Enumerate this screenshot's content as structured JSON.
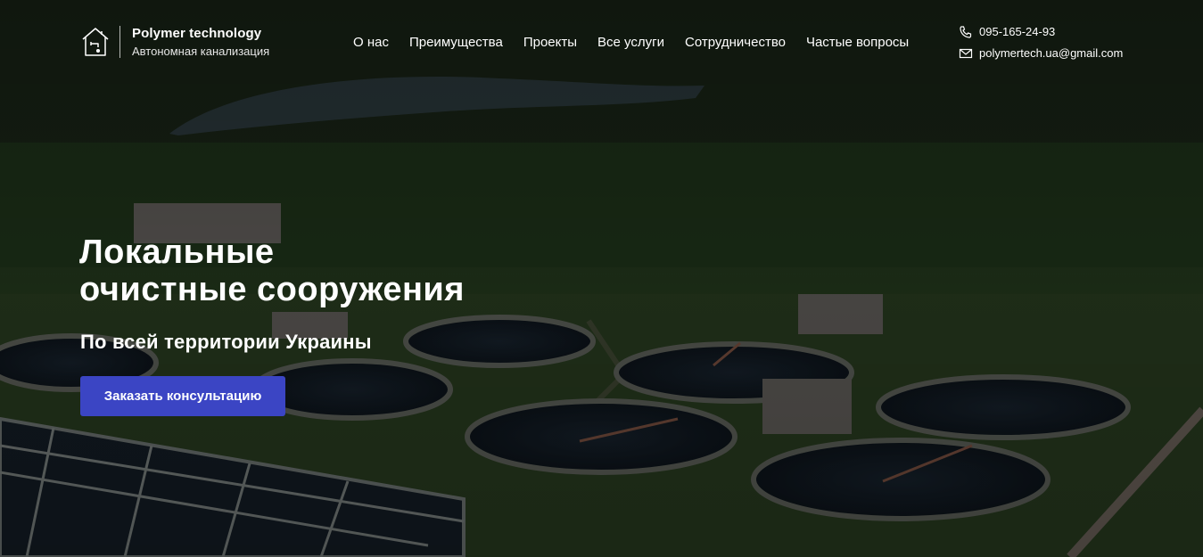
{
  "brand": {
    "name": "Polymer technology",
    "tagline": "Автономная канализация",
    "icon": "house-faucet-icon"
  },
  "nav": {
    "items": [
      {
        "label": "О нас"
      },
      {
        "label": "Преимущества"
      },
      {
        "label": "Проекты"
      },
      {
        "label": "Все услуги"
      },
      {
        "label": "Сотрудничество"
      },
      {
        "label": "Частые вопросы"
      }
    ]
  },
  "contacts": {
    "phone": "095-165-24-93",
    "email": "polymertech.ua@gmail.com",
    "phone_icon": "phone-icon",
    "email_icon": "envelope-icon"
  },
  "hero": {
    "title_line1": "Локальные",
    "title_line2": "очистные сооружения",
    "subtitle": "По всей территории Украины",
    "cta_label": "Заказать консультацию",
    "background": "aerial-wastewater-treatment-plant-photo"
  },
  "colors": {
    "accent": "#3b45c4",
    "text": "#ffffff"
  }
}
